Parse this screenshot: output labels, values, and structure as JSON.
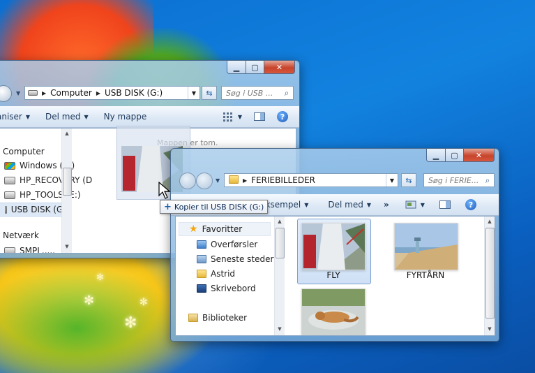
{
  "colors": {
    "selection": "#cfe0f6",
    "close": "#c7442c",
    "link": "#1e395b"
  },
  "window_back": {
    "address": {
      "segments": [
        "Computer",
        "USB DISK (G:)"
      ]
    },
    "search_placeholder": "Søg i USB ...",
    "toolbar": {
      "organize": "aniser",
      "share": "Del med",
      "new_folder": "Ny mappe"
    },
    "empty_text": "Mappen er tom.",
    "nav": [
      "Computer",
      "Windows  (C:)",
      "HP_RECOVERY (D",
      "HP_TOOLS (E:)",
      "USB DISK (G:)",
      "Netværk",
      "SMPL....."
    ]
  },
  "window_front": {
    "address": {
      "segments": [
        "FERIEBILLEDER"
      ]
    },
    "search_placeholder": "Søg i FERIE...",
    "toolbar": {
      "preview": "Eksempel",
      "share": "Del med",
      "more": "»"
    },
    "nav": {
      "favorites": "Favoritter",
      "items": [
        "Overførsler",
        "Seneste steder",
        "Astrid",
        "Skrivebord"
      ],
      "libraries": "Biblioteker"
    },
    "files": [
      {
        "name": "FLY",
        "selected": true
      },
      {
        "name": "FYRTÅRN",
        "selected": false
      },
      {
        "name": "",
        "selected": false
      }
    ]
  },
  "drag": {
    "tooltip": "Kopier til USB DISK (G:)"
  }
}
